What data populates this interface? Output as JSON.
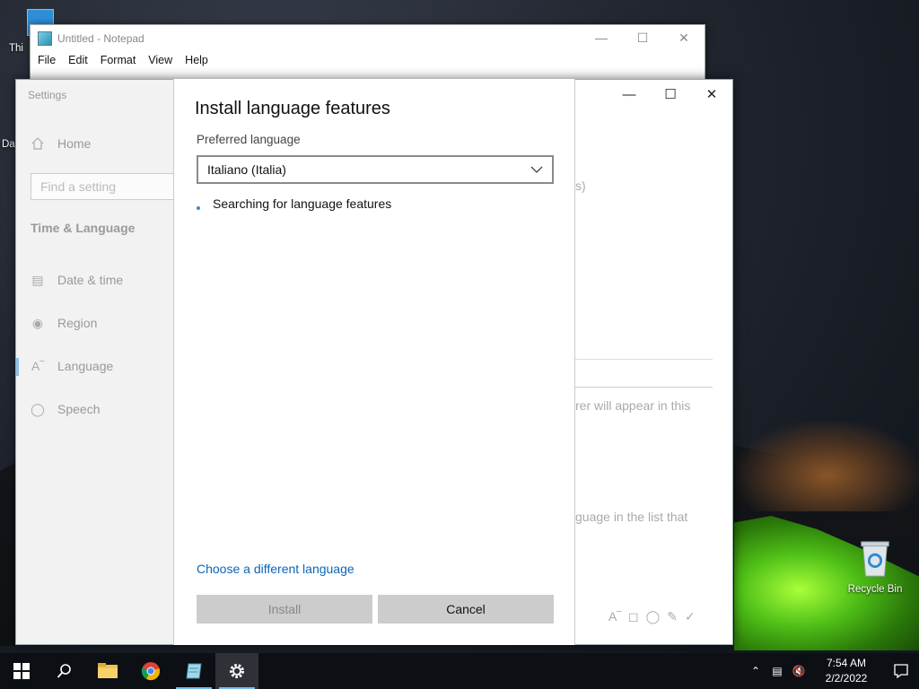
{
  "desktop": {
    "icon_this_pc_label": "Thi",
    "icon_da_label": "Da",
    "recycle_bin_label": "Recycle Bin"
  },
  "notepad": {
    "title": "Untitled - Notepad",
    "menu": [
      "File",
      "Edit",
      "Format",
      "View",
      "Help"
    ]
  },
  "settings": {
    "title": "Settings",
    "home_label": "Home",
    "search_placeholder": "Find a setting",
    "section_title": "Time & Language",
    "nav": [
      {
        "label": "Date & time",
        "icon": "calendar-clock-icon"
      },
      {
        "label": "Region",
        "icon": "globe-icon"
      },
      {
        "label": "Language",
        "icon": "language-icon"
      },
      {
        "label": "Speech",
        "icon": "microphone-icon"
      }
    ],
    "background_text": {
      "paren": "s)",
      "appear_text": "rer will appear in this",
      "list_text": "guage in the list that"
    }
  },
  "dialog": {
    "title": "Install language features",
    "preferred_label": "Preferred language",
    "selected_language": "Italiano (Italia)",
    "status_text": "Searching for language features",
    "choose_link": "Choose a different language",
    "install_button": "Install",
    "cancel_button": "Cancel"
  },
  "taskbar": {
    "time": "7:54 AM",
    "date": "2/2/2022"
  },
  "colors": {
    "accent": "#0a66b8",
    "taskbar": "#0c0f14",
    "button_gray": "#cccccc"
  }
}
